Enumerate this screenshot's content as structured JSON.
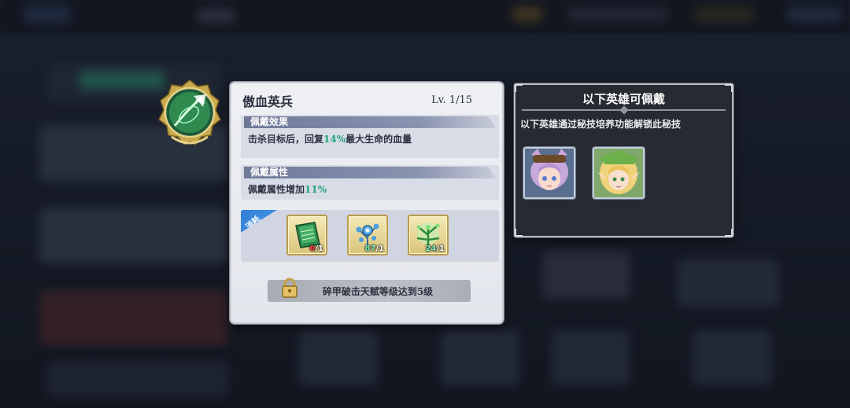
{
  "skill": {
    "name": "傲血英兵",
    "level_text": "Lv.  1/15",
    "effect_header": "佩戴效果",
    "effect_pre": "击杀目标后，回复",
    "effect_value": "14%",
    "effect_post": "最大生命的血量",
    "attr_header": "佩戴属性",
    "attr_pre": "佩戴属性增加",
    "attr_value": "11%"
  },
  "consume": {
    "tag": "消耗",
    "items": [
      {
        "name": "green-book-icon",
        "have": "0",
        "need": "/1",
        "sufficient": false
      },
      {
        "name": "blue-flower-icon",
        "have": "87",
        "need": "/1",
        "sufficient": true
      },
      {
        "name": "green-plant-icon",
        "have": "24",
        "need": "/1",
        "sufficient": true
      }
    ]
  },
  "unlock": {
    "text": "碎甲破击天赋等级达到5级"
  },
  "hero_panel": {
    "title": "以下英雄可佩戴",
    "subtitle": "以下英雄通过秘技培养功能解锁此秘技",
    "heroes": [
      {
        "name": "purple-hair-hero-portrait"
      },
      {
        "name": "blonde-elf-hero-portrait"
      }
    ]
  },
  "colors": {
    "highlight_green": "#21a37a",
    "lack_red": "#ff3d3d",
    "tag_blue": "#3b8fe0"
  }
}
